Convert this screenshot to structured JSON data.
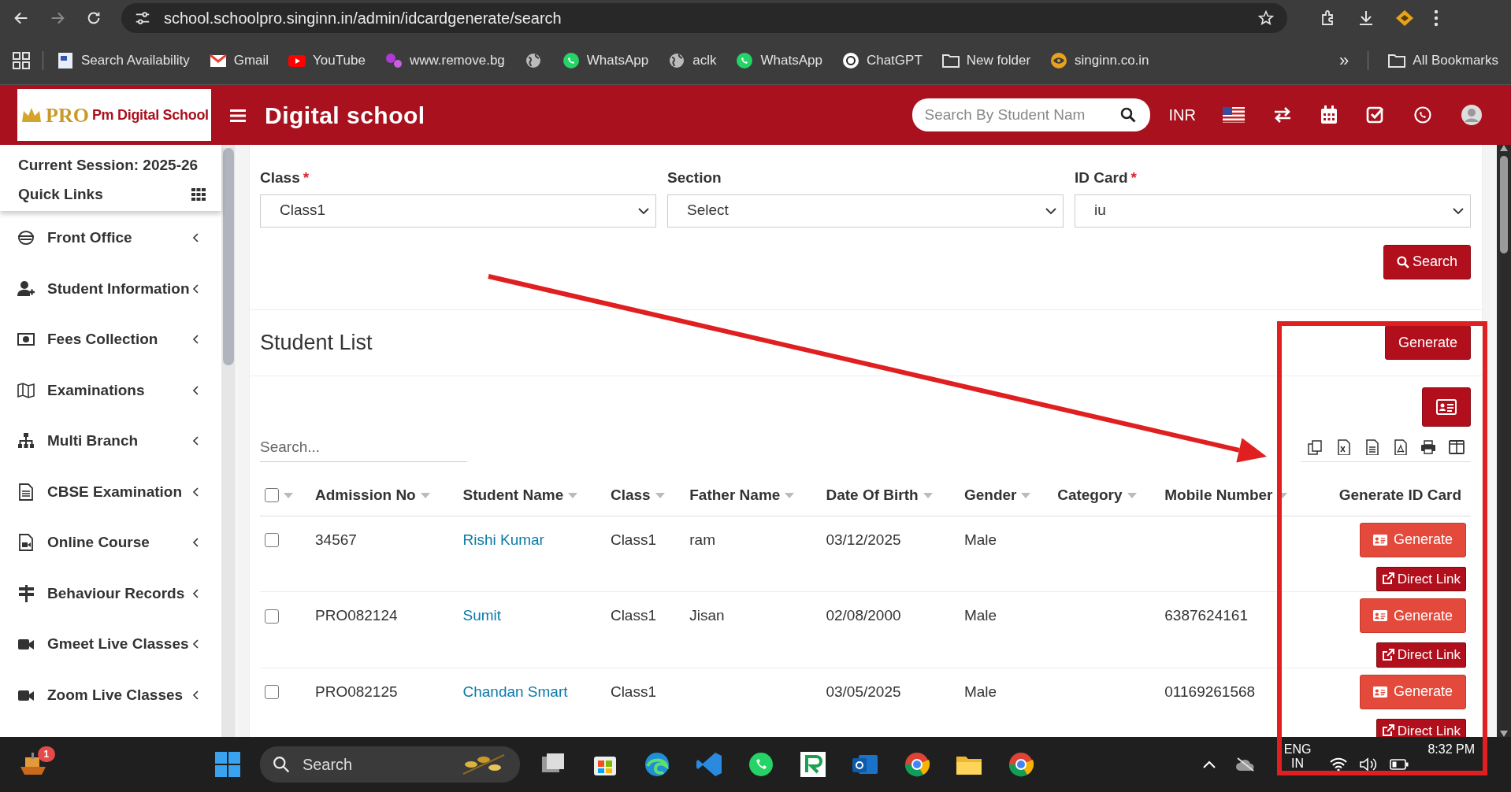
{
  "browser": {
    "url": "school.schoolpro.singinn.in/admin/idcardgenerate/search",
    "bookmarks": [
      {
        "label": "Search Availability"
      },
      {
        "label": "Gmail"
      },
      {
        "label": "YouTube"
      },
      {
        "label": "www.remove.bg"
      },
      {
        "kind": "icon"
      },
      {
        "label": "WhatsApp"
      },
      {
        "label": "aclk"
      },
      {
        "label": "WhatsApp"
      },
      {
        "label": "ChatGPT"
      },
      {
        "label": "New folder"
      },
      {
        "label": "singinn.co.in"
      }
    ],
    "overflow": "»",
    "all_bookmarks": "All Bookmarks"
  },
  "header": {
    "logo_mark": "PRO",
    "logo_name": "Pm Digital School",
    "title": "Digital school",
    "search_placeholder": "Search By Student Nam",
    "currency": "INR"
  },
  "sidebar": {
    "session": "Current Session: 2025-26",
    "quick_links": "Quick Links",
    "items": [
      {
        "label": "Front Office",
        "expanded": false
      },
      {
        "label": "Student Information",
        "expanded": false
      },
      {
        "label": "Fees Collection",
        "expanded": false
      },
      {
        "label": "Examinations",
        "expanded": false
      },
      {
        "label": "Multi Branch",
        "expanded": false
      },
      {
        "label": "CBSE Examination",
        "expanded": false
      },
      {
        "label": "Online Course",
        "expanded": false
      },
      {
        "label": "Behaviour Records",
        "expanded": false
      },
      {
        "label": "Gmeet Live Classes",
        "expanded": false
      },
      {
        "label": "Zoom Live Classes",
        "expanded": false
      }
    ]
  },
  "filters": {
    "fields": [
      {
        "label": "Class",
        "required": true,
        "value": "Class1"
      },
      {
        "label": "Section",
        "required": false,
        "value": "Select"
      },
      {
        "label": "ID Card",
        "required": true,
        "value": "iu"
      }
    ],
    "required_mark": "*",
    "search_button": "Search"
  },
  "student_list": {
    "title": "Student List",
    "generate_button": "Generate",
    "search_placeholder": "Search...",
    "all_checked": false,
    "columns": [
      "Admission No",
      "Student Name",
      "Class",
      "Father Name",
      "Date Of Birth",
      "Gender",
      "Category",
      "Mobile Number",
      "Generate ID Card"
    ],
    "rows": [
      {
        "checked": false,
        "admission_no": "34567",
        "name": "Rishi Kumar",
        "class": "Class1",
        "father": "ram",
        "dob": "03/12/2025",
        "gender": "Male",
        "generate": "Generate",
        "direct_link": "Direct Link"
      },
      {
        "checked": false,
        "admission_no": "PRO082124",
        "name": "Sumit",
        "class": "Class1",
        "father": "Jisan",
        "dob": "02/08/2000",
        "gender": "Male",
        "mobile": "6387624161",
        "generate": "Generate",
        "direct_link": "Direct Link"
      },
      {
        "checked": false,
        "admission_no": "PRO082125",
        "name": "Chandan Smart",
        "class": "Class1",
        "dob": "03/05/2025",
        "gender": "Male",
        "mobile": "01169261568",
        "generate": "Generate",
        "direct_link": "Direct Link"
      }
    ]
  },
  "annotations": [
    {
      "kind": "arrow"
    },
    {
      "kind": "rectangle"
    }
  ],
  "taskbar": {
    "notification_count": "1",
    "search_placeholder": "Search",
    "language": "ENG",
    "region": "IN",
    "time": "8:32 PM"
  }
}
